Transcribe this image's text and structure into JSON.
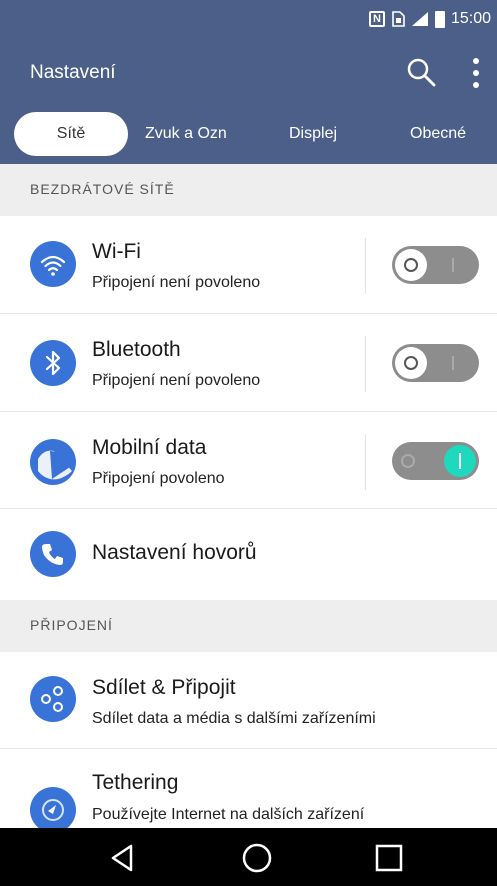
{
  "status_bar": {
    "time": "15:00",
    "nfc_label": "N",
    "icons": [
      "nfc-icon",
      "sim-icon",
      "signal-icon",
      "battery-icon"
    ]
  },
  "app_bar": {
    "title": "Nastavení",
    "icons": [
      "search-icon",
      "more-vert-icon"
    ]
  },
  "tabs": [
    "Sítě",
    "Zvuk a Ozn",
    "Displej",
    "Obecné"
  ],
  "sections": {
    "wireless": "BEZDRÁTOVÉ SÍTĚ",
    "connection": "PŘIPOJENÍ"
  },
  "rows": [
    {
      "title": "Wi-Fi",
      "subtitle": "Připojení není povoleno",
      "icon": "wifi-icon",
      "toggle": false
    },
    {
      "title": "Bluetooth",
      "subtitle": "Připojení není povoleno",
      "icon": "bluetooth-icon",
      "toggle": false
    },
    {
      "title": "Mobilní data",
      "subtitle": "Připojení povoleno",
      "icon": "mobile-data-icon",
      "toggle": true
    },
    {
      "title": "Nastavení hovorů",
      "subtitle": "",
      "icon": "phone-icon"
    },
    {
      "title": "Sdílet & Připojit",
      "subtitle": "Sdílet data a média s dalšími zařízeními",
      "icon": "share-icon"
    },
    {
      "title": "Tethering",
      "subtitle": "Používejte Internet na dalších zařízení",
      "icon": "tethering-icon"
    }
  ],
  "nav_bar": {
    "icons": [
      "back-icon",
      "home-icon",
      "recents-icon"
    ]
  },
  "colors": {
    "header": "#4b5f88",
    "accent": "#3a73d8",
    "toggle_on": "#1ed9bd"
  }
}
